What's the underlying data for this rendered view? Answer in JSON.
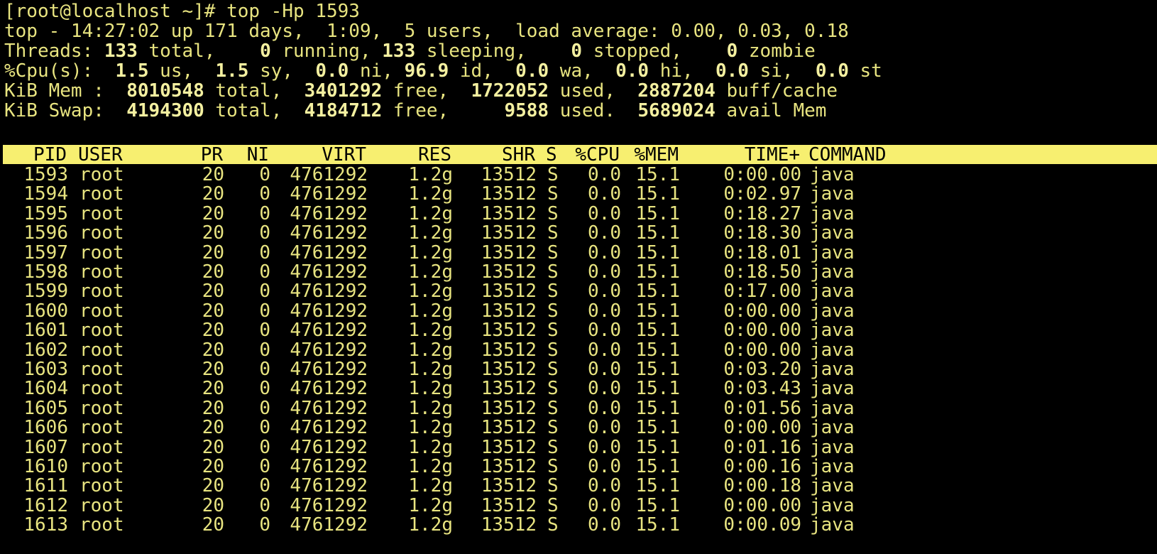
{
  "terminal": {
    "prompt": "[root@localhost ~]# top -Hp 1593",
    "summary": {
      "time": "14:27:02",
      "uptime_days": "171 days,",
      "uptime_time": "1:09,",
      "users": "5 users,",
      "load_average": "0.00, 0.03, 0.18",
      "threads_total": "133",
      "threads_running": "0",
      "threads_sleeping": "133",
      "threads_stopped": "0",
      "threads_zombie": "0",
      "cpu_us": "1.5",
      "cpu_sy": "1.5",
      "cpu_ni": "0.0",
      "cpu_id": "96.9",
      "cpu_wa": "0.0",
      "cpu_hi": "0.0",
      "cpu_si": "0.0",
      "cpu_st": "0.0",
      "mem_total": "8010548",
      "mem_free": "3401292",
      "mem_used": "1722052",
      "mem_buff": "2887204",
      "swap_total": "4194300",
      "swap_free": "4184712",
      "swap_used": "9588",
      "swap_avail": "5689024"
    },
    "labels": {
      "top_prefix": "top - ",
      "up": " up ",
      "load_label": "load average: ",
      "threads_label": "Threads: ",
      "total": " total,",
      "running": " running,",
      "sleeping": " sleeping,",
      "stopped": " stopped,",
      "zombie": " zombie",
      "cpu_label": "%Cpu(s):",
      "us": " us,",
      "sy": " sy,",
      "ni": " ni,",
      "id": " id,",
      "wa": " wa,",
      "hi": " hi,",
      "si": " si,",
      "st": " st",
      "mem_label": "KiB Mem :",
      "swap_label": "KiB Swap:",
      "free": " free,",
      "used_comma": " used,",
      "used_dot": " used.",
      "buff": " buff/cache",
      "avail": " avail Mem"
    },
    "columns": [
      "PID",
      "USER",
      "PR",
      "NI",
      "VIRT",
      "RES",
      "SHR",
      "S",
      "%CPU",
      "%MEM",
      "TIME+",
      "COMMAND"
    ],
    "rows": [
      [
        "1593",
        "root",
        "20",
        "0",
        "4761292",
        "1.2g",
        "13512",
        "S",
        "0.0",
        "15.1",
        "0:00.00",
        "java"
      ],
      [
        "1594",
        "root",
        "20",
        "0",
        "4761292",
        "1.2g",
        "13512",
        "S",
        "0.0",
        "15.1",
        "0:02.97",
        "java"
      ],
      [
        "1595",
        "root",
        "20",
        "0",
        "4761292",
        "1.2g",
        "13512",
        "S",
        "0.0",
        "15.1",
        "0:18.27",
        "java"
      ],
      [
        "1596",
        "root",
        "20",
        "0",
        "4761292",
        "1.2g",
        "13512",
        "S",
        "0.0",
        "15.1",
        "0:18.30",
        "java"
      ],
      [
        "1597",
        "root",
        "20",
        "0",
        "4761292",
        "1.2g",
        "13512",
        "S",
        "0.0",
        "15.1",
        "0:18.01",
        "java"
      ],
      [
        "1598",
        "root",
        "20",
        "0",
        "4761292",
        "1.2g",
        "13512",
        "S",
        "0.0",
        "15.1",
        "0:18.50",
        "java"
      ],
      [
        "1599",
        "root",
        "20",
        "0",
        "4761292",
        "1.2g",
        "13512",
        "S",
        "0.0",
        "15.1",
        "0:17.00",
        "java"
      ],
      [
        "1600",
        "root",
        "20",
        "0",
        "4761292",
        "1.2g",
        "13512",
        "S",
        "0.0",
        "15.1",
        "0:00.00",
        "java"
      ],
      [
        "1601",
        "root",
        "20",
        "0",
        "4761292",
        "1.2g",
        "13512",
        "S",
        "0.0",
        "15.1",
        "0:00.00",
        "java"
      ],
      [
        "1602",
        "root",
        "20",
        "0",
        "4761292",
        "1.2g",
        "13512",
        "S",
        "0.0",
        "15.1",
        "0:00.00",
        "java"
      ],
      [
        "1603",
        "root",
        "20",
        "0",
        "4761292",
        "1.2g",
        "13512",
        "S",
        "0.0",
        "15.1",
        "0:03.20",
        "java"
      ],
      [
        "1604",
        "root",
        "20",
        "0",
        "4761292",
        "1.2g",
        "13512",
        "S",
        "0.0",
        "15.1",
        "0:03.43",
        "java"
      ],
      [
        "1605",
        "root",
        "20",
        "0",
        "4761292",
        "1.2g",
        "13512",
        "S",
        "0.0",
        "15.1",
        "0:01.56",
        "java"
      ],
      [
        "1606",
        "root",
        "20",
        "0",
        "4761292",
        "1.2g",
        "13512",
        "S",
        "0.0",
        "15.1",
        "0:00.00",
        "java"
      ],
      [
        "1607",
        "root",
        "20",
        "0",
        "4761292",
        "1.2g",
        "13512",
        "S",
        "0.0",
        "15.1",
        "0:01.16",
        "java"
      ],
      [
        "1610",
        "root",
        "20",
        "0",
        "4761292",
        "1.2g",
        "13512",
        "S",
        "0.0",
        "15.1",
        "0:00.16",
        "java"
      ],
      [
        "1611",
        "root",
        "20",
        "0",
        "4761292",
        "1.2g",
        "13512",
        "S",
        "0.0",
        "15.1",
        "0:00.18",
        "java"
      ],
      [
        "1612",
        "root",
        "20",
        "0",
        "4761292",
        "1.2g",
        "13512",
        "S",
        "0.0",
        "15.1",
        "0:00.00",
        "java"
      ],
      [
        "1613",
        "root",
        "20",
        "0",
        "4761292",
        "1.2g",
        "13512",
        "S",
        "0.0",
        "15.1",
        "0:00.09",
        "java"
      ]
    ],
    "colors": {
      "foreground": "#e8e480",
      "background": "#000000",
      "header_bar": "#f7ef70"
    }
  }
}
